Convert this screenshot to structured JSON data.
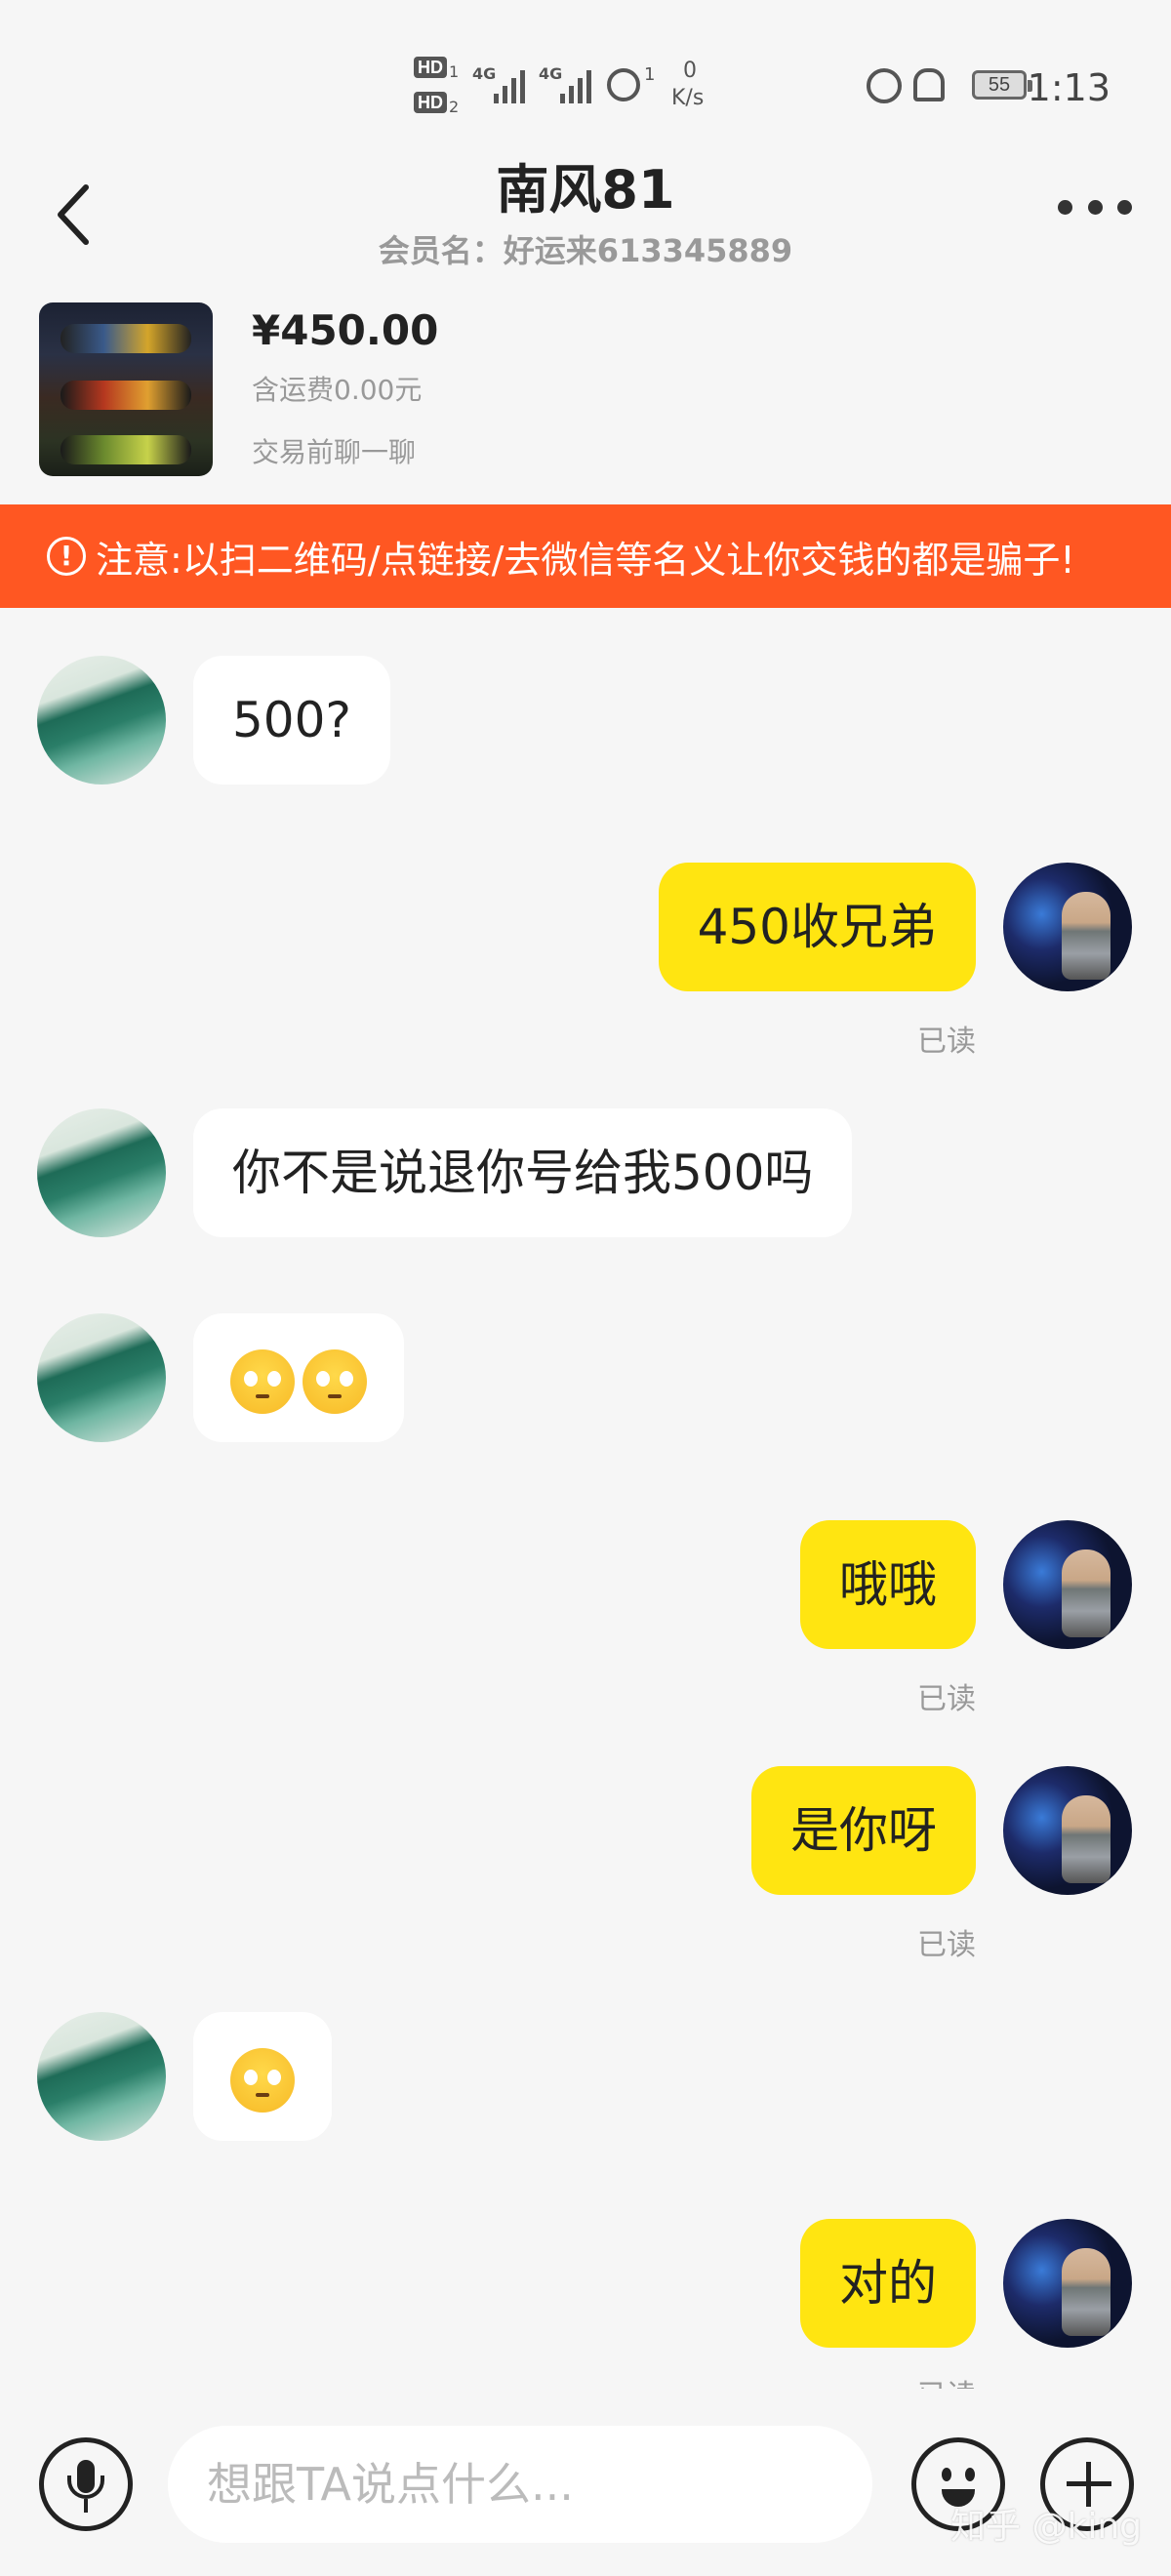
{
  "status_bar": {
    "hd1": "HD",
    "hd1_sub": "1",
    "hd2": "HD",
    "hd2_sub": "2",
    "net1": "4G",
    "net2": "4G",
    "hotspot_count": "1",
    "speed_value": "0",
    "speed_unit": "K/s",
    "battery": "55",
    "time": "1:13"
  },
  "header": {
    "title": "南风81",
    "subtitle": "会员名：好运来613345889"
  },
  "product": {
    "price": "¥450.00",
    "shipping": "含运费0.00元",
    "note": "交易前聊一聊"
  },
  "warning": {
    "icon_text": "!",
    "text": "注意:以扫二维码/点链接/去微信等名义让你交钱的都是骗子!"
  },
  "messages": {
    "m1": "500?",
    "m2": "450收兄弟",
    "m3": "你不是说退你号给我500吗",
    "m5": "哦哦",
    "m6": "是你呀",
    "m8": "对的",
    "read_label": "已读"
  },
  "input": {
    "placeholder": "想跟TA说点什么..."
  },
  "watermark": "知乎 @king",
  "colors": {
    "warning_bg": "#ff5722",
    "self_bubble": "#ffe511",
    "other_bubble": "#ffffff",
    "background": "#f6f6f6"
  },
  "icons": [
    "back-arrow-icon",
    "more-dots-icon",
    "warning-icon",
    "microphone-icon",
    "emoji-icon",
    "plus-icon",
    "pleading-face-emoji"
  ]
}
